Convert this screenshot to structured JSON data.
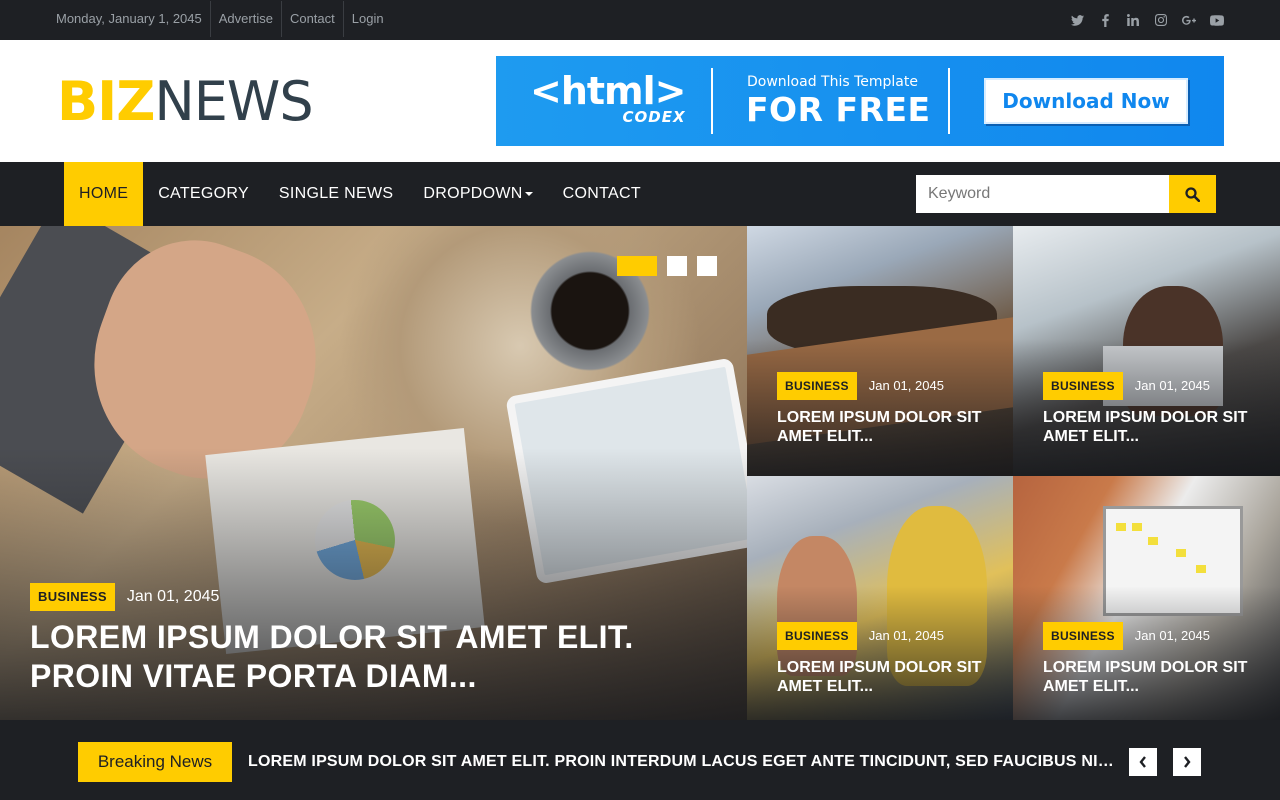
{
  "topbar": {
    "date": "Monday, January 1, 2045",
    "links": [
      "Advertise",
      "Contact",
      "Login"
    ],
    "social_icons": [
      "twitter-icon",
      "facebook-icon",
      "linkedin-icon",
      "instagram-icon",
      "google-plus-icon",
      "youtube-icon"
    ]
  },
  "header": {
    "logo_part1": "BIZ",
    "logo_part2": "NEWS",
    "banner": {
      "brand": "<html>",
      "brand_sub": "CODEX",
      "line1": "Download This Template",
      "line2": "FOR FREE",
      "button": "Download Now"
    }
  },
  "nav": {
    "items": [
      "HOME",
      "CATEGORY",
      "SINGLE NEWS",
      "DROPDOWN",
      "CONTACT"
    ],
    "active": "HOME",
    "search_placeholder": "Keyword"
  },
  "hero": {
    "category": "BUSINESS",
    "date": "Jan 01, 2045",
    "title": "LOREM IPSUM DOLOR SIT AMET ELIT. PROIN VITAE PORTA DIAM..."
  },
  "slider": {
    "slides": 3,
    "active_index": 0
  },
  "side_news": [
    {
      "category": "BUSINESS",
      "date": "Jan 01, 2045",
      "title": "LOREM IPSUM DOLOR SIT AMET ELIT..."
    },
    {
      "category": "BUSINESS",
      "date": "Jan 01, 2045",
      "title": "LOREM IPSUM DOLOR SIT AMET ELIT..."
    },
    {
      "category": "BUSINESS",
      "date": "Jan 01, 2045",
      "title": "LOREM IPSUM DOLOR SIT AMET ELIT..."
    },
    {
      "category": "BUSINESS",
      "date": "Jan 01, 2045",
      "title": "LOREM IPSUM DOLOR SIT AMET ELIT..."
    }
  ],
  "breaking": {
    "label": "Breaking News",
    "text": "LOREM IPSUM DOLOR SIT AMET ELIT. PROIN INTERDUM LACUS EGET ANTE TINCIDUNT, SED FAUCIBUS NISL SODALES"
  },
  "colors": {
    "accent": "#ffcc00",
    "dark": "#1e2024",
    "logo_dark": "#31404b",
    "banner_blue": "#1087ee"
  }
}
